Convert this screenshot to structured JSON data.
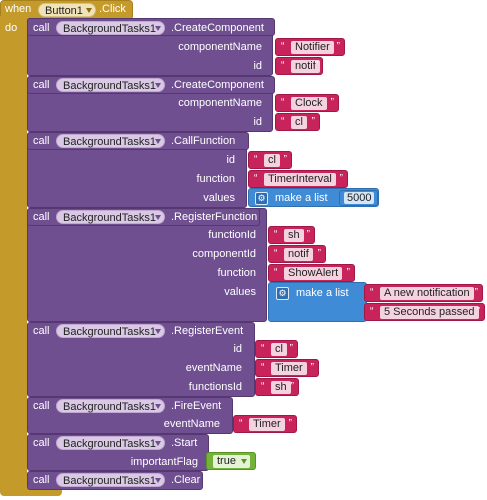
{
  "event": {
    "when_label": "when",
    "component": "Button1",
    "event_name": ".Click",
    "do_label": "do"
  },
  "common": {
    "call_label": "call"
  },
  "blocks": [
    {
      "component": "BackgroundTasks1",
      "method": ".CreateComponent",
      "params": [
        {
          "label": "componentName",
          "value": "Notifier"
        },
        {
          "label": "id",
          "value": "notif"
        }
      ]
    },
    {
      "component": "BackgroundTasks1",
      "method": ".CreateComponent",
      "params": [
        {
          "label": "componentName",
          "value": "Clock"
        },
        {
          "label": "id",
          "value": "cl"
        }
      ]
    },
    {
      "component": "BackgroundTasks1",
      "method": ".CallFunction",
      "params": [
        {
          "label": "id",
          "value": "cl"
        },
        {
          "label": "function",
          "value": "TimerInterval"
        },
        {
          "label": "values"
        }
      ],
      "list": {
        "label": "make a list",
        "items": [
          "5000"
        ]
      }
    },
    {
      "component": "BackgroundTasks1",
      "method": ".RegisterFunction",
      "params": [
        {
          "label": "functionId",
          "value": "sh"
        },
        {
          "label": "componentId",
          "value": "notif"
        },
        {
          "label": "function",
          "value": "ShowAlert"
        },
        {
          "label": "values"
        }
      ],
      "list": {
        "label": "make a list",
        "items": [
          "A new notification",
          "5 Seconds passed"
        ]
      }
    },
    {
      "component": "BackgroundTasks1",
      "method": ".RegisterEvent",
      "params": [
        {
          "label": "id",
          "value": "cl"
        },
        {
          "label": "eventName",
          "value": "Timer"
        },
        {
          "label": "functionsId",
          "value": "sh"
        }
      ]
    },
    {
      "component": "BackgroundTasks1",
      "method": ".FireEvent",
      "params": [
        {
          "label": "eventName",
          "value": "Timer"
        }
      ]
    },
    {
      "component": "BackgroundTasks1",
      "method": ".Start",
      "params": [
        {
          "label": "importantFlag",
          "value": "true"
        }
      ]
    },
    {
      "component": "BackgroundTasks1",
      "method": ".Clear",
      "params": []
    }
  ],
  "colors": {
    "event": "#c49a2a",
    "method": "#6f4f90",
    "text": "#c8235a",
    "list": "#3f8bd6",
    "logic": "#74b33a"
  }
}
